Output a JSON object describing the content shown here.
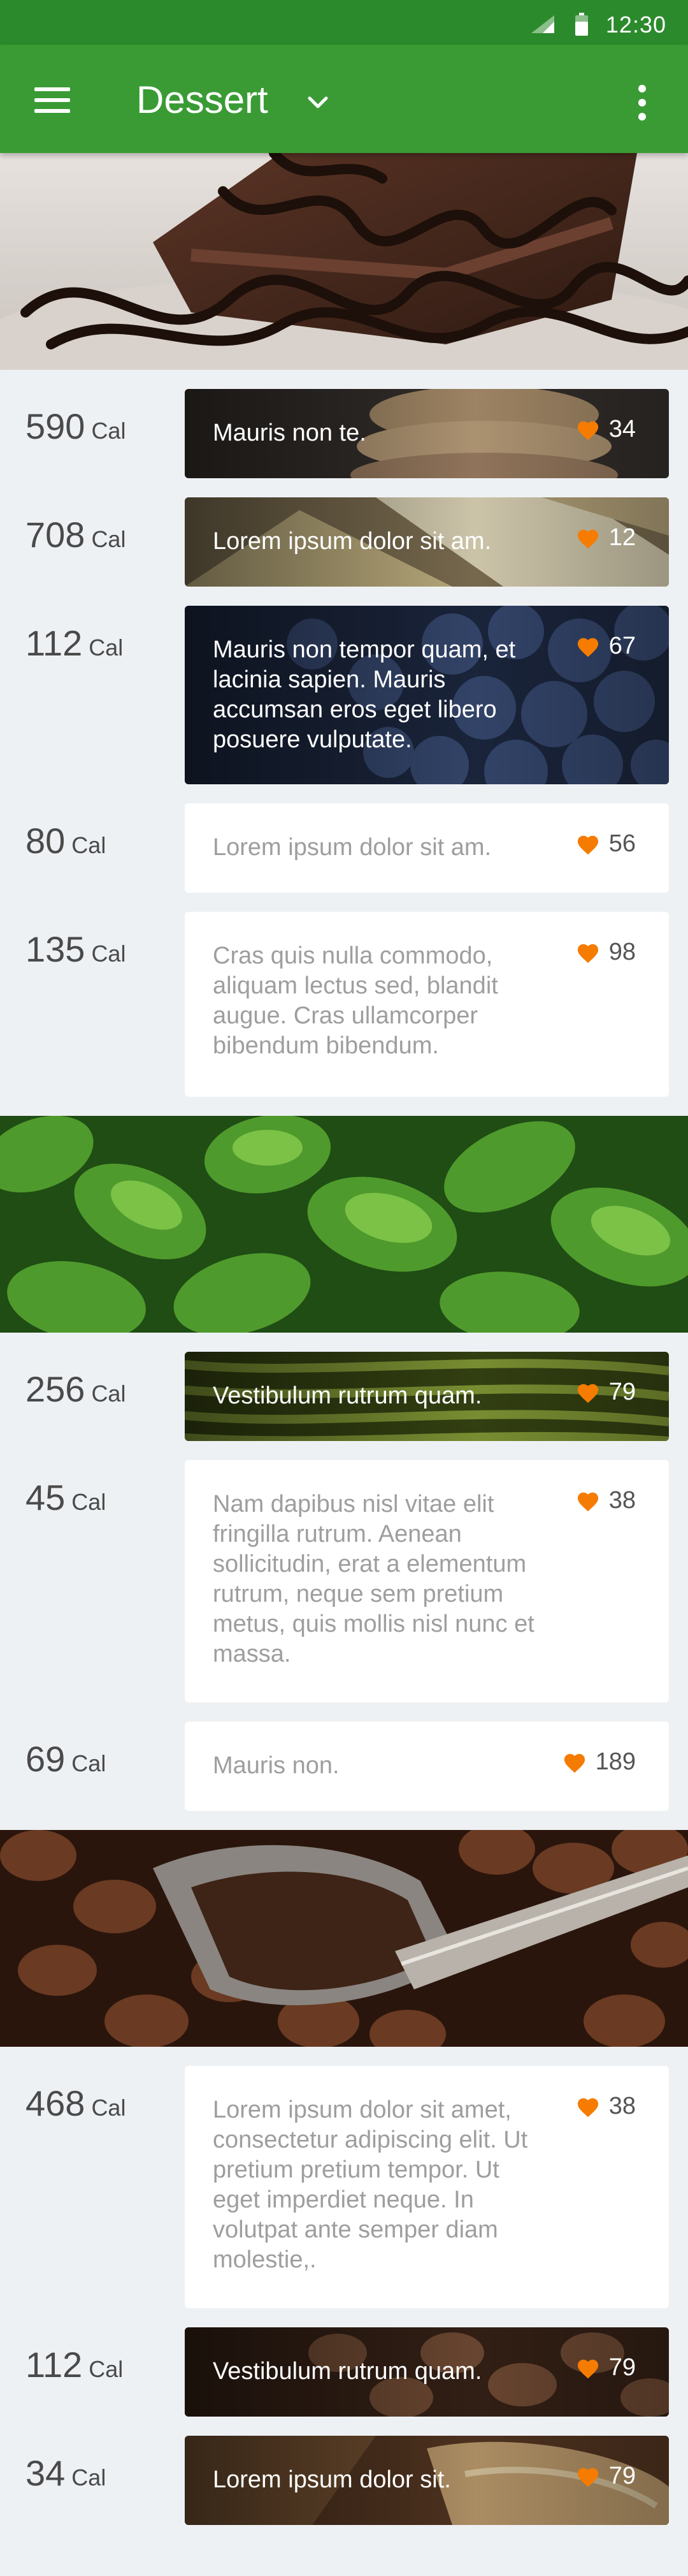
{
  "status": {
    "time": "12:30",
    "icons": [
      "signal-icon",
      "battery-icon"
    ]
  },
  "appbar": {
    "title": "Dessert",
    "icons": [
      "menu-icon",
      "chevron-down-icon",
      "more-vert-icon"
    ]
  },
  "colors": {
    "primary": "#3a9b35",
    "primary_dark": "#2b8a2b",
    "heart": "#f57c00",
    "background": "#eef1f4"
  },
  "unit": "Cal",
  "sections": [
    {
      "banner": "chocolate-cake-image",
      "items": [
        {
          "cal": "590",
          "text": "Mauris non te.",
          "likes": "34",
          "style": "image"
        },
        {
          "cal": "708",
          "text": "Lorem ipsum dolor sit am.",
          "likes": "12",
          "style": "image"
        },
        {
          "cal": "112",
          "text": "Mauris non tempor quam, et lacinia sapien. Mauris accumsan eros eget libero posuere vulputate.",
          "likes": "67",
          "style": "image"
        },
        {
          "cal": "80",
          "text": "Lorem ipsum dolor sit am.",
          "likes": "56",
          "style": "plain"
        },
        {
          "cal": "135",
          "text": "Cras quis nulla commodo, aliquam lectus sed, blandit augue. Cras ullamcorper bibendum bibendum.",
          "likes": "98",
          "style": "plain"
        }
      ]
    },
    {
      "banner": "green-leaves-image",
      "items": [
        {
          "cal": "256",
          "text": "Vestibulum rutrum quam.",
          "likes": "79",
          "style": "image"
        },
        {
          "cal": "45",
          "text": "Nam dapibus nisl vitae elit fringilla rutrum. Aenean sollicitudin, erat a elementum rutrum, neque sem pretium metus, quis mollis nisl nunc et massa.",
          "likes": "38",
          "style": "plain"
        },
        {
          "cal": "69",
          "text": "Mauris non.",
          "likes": "189",
          "style": "plain"
        }
      ]
    },
    {
      "banner": "coffee-beans-image",
      "items": [
        {
          "cal": "468",
          "text": "Lorem ipsum dolor sit amet, consectetur adipiscing elit. Ut pretium pretium tempor. Ut eget imperdiet neque. In volutpat ante semper diam molestie,.",
          "likes": "38",
          "style": "plain"
        },
        {
          "cal": "112",
          "text": "Vestibulum rutrum quam.",
          "likes": "79",
          "style": "image"
        },
        {
          "cal": "34",
          "text": "Lorem ipsum dolor sit.",
          "likes": "79",
          "style": "image"
        }
      ]
    }
  ]
}
